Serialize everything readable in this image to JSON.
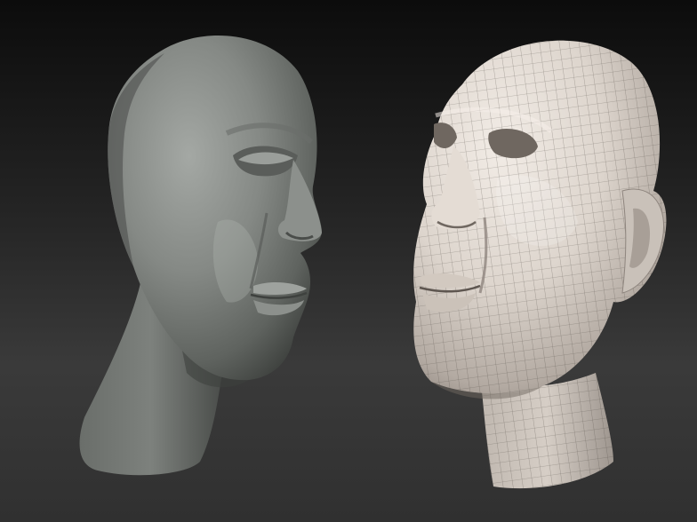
{
  "scene": {
    "background_top": "#0c0c0c",
    "background_bottom": "#3a3a3a",
    "models": [
      {
        "name": "sculpt-head-smooth",
        "material": "clay-gray",
        "color": "#858985"
      },
      {
        "name": "sculpt-head-wireframe",
        "material": "matcap-white-with-polygroup-wireframe",
        "color": "#d8d0c8"
      }
    ]
  }
}
